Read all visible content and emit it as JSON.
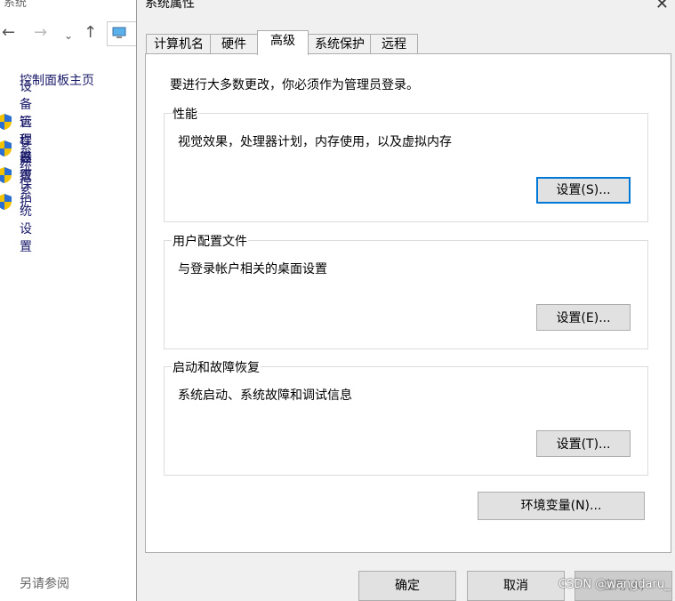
{
  "bg_window": {
    "title": "系统",
    "home_link": "控制面板主页",
    "side_items": [
      {
        "label": "设备管理器",
        "icon": "shield-icon"
      },
      {
        "label": "远程设置",
        "icon": "shield-icon"
      },
      {
        "label": "系统保护",
        "icon": "shield-icon"
      },
      {
        "label": "高级系统设置",
        "icon": "shield-icon"
      }
    ],
    "see_also": "另请参阅",
    "nav": {
      "back": "←",
      "forward": "→",
      "dropdown": "⌄",
      "up": "↑"
    }
  },
  "dialog": {
    "title": "系统属性",
    "close_glyph": "✕",
    "tabs": [
      {
        "label": "计算机名"
      },
      {
        "label": "硬件"
      },
      {
        "label": "高级",
        "active": true
      },
      {
        "label": "系统保护"
      },
      {
        "label": "远程"
      }
    ],
    "admin_note": "要进行大多数更改，你必须作为管理员登录。",
    "groups": [
      {
        "title": "性能",
        "desc": "视觉效果，处理器计划，内存使用，以及虚拟内存",
        "button": "设置(S)..."
      },
      {
        "title": "用户配置文件",
        "desc": "与登录帐户相关的桌面设置",
        "button": "设置(E)..."
      },
      {
        "title": "启动和故障恢复",
        "desc": "系统启动、系统故障和调试信息",
        "button": "设置(T)..."
      }
    ],
    "env_button": "环境变量(N)...",
    "footer": {
      "ok": "确定",
      "cancel": "取消",
      "apply": "应用(A)"
    },
    "watermark": "CSDN @wangdaru_"
  },
  "colors": {
    "accent": "#0078d7",
    "dialog_bg": "#f0f0f0",
    "button_bg": "#e1e1e1",
    "link": "#1a1a6a"
  }
}
